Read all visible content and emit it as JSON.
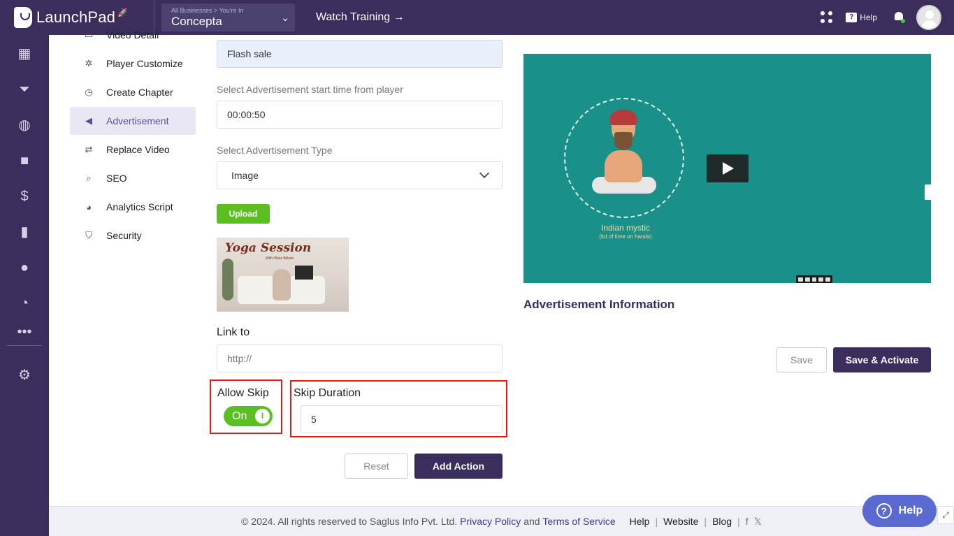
{
  "app": {
    "name": "LaunchPad"
  },
  "business": {
    "crumb": "All Businesses > You're In",
    "name": "Concepta"
  },
  "topnav": {
    "watch_training": "Watch Training →",
    "help": "Help"
  },
  "rail_icons": [
    "dashboard-icon",
    "funnel-icon",
    "globe-icon",
    "video-icon",
    "dollar-icon",
    "analytics-icon",
    "users-icon",
    "gauge-icon",
    "more-icon",
    "settings-icon"
  ],
  "submenu": {
    "items": [
      {
        "label": "Video Detail",
        "icon": "video-detail-icon"
      },
      {
        "label": "Player Customize",
        "icon": "customize-icon"
      },
      {
        "label": "Create Chapter",
        "icon": "stopwatch-icon"
      },
      {
        "label": "Advertisement",
        "icon": "megaphone-icon",
        "active": true
      },
      {
        "label": "Replace Video",
        "icon": "swap-icon"
      },
      {
        "label": "SEO",
        "icon": "seo-search-icon"
      },
      {
        "label": "Analytics Script",
        "icon": "pie-chart-icon"
      },
      {
        "label": "Security",
        "icon": "shield-icon"
      }
    ]
  },
  "form": {
    "ad_name_value": "Flash sale",
    "start_time_label": "Select Advertisement start time from player",
    "start_time_value": "00:00:50",
    "type_label": "Select Advertisement Type",
    "type_value": "Image",
    "upload_label": "Upload",
    "thumb_title": "Yoga Session",
    "thumb_sub": "With Olivia Wilson",
    "link_label": "Link to",
    "link_placeholder": "http://",
    "allow_skip_label": "Allow Skip",
    "allow_skip_state": "On",
    "toggle_knob": "I",
    "skip_duration_label": "Skip Duration",
    "skip_duration_value": "5",
    "reset_label": "Reset",
    "add_action_label": "Add Action"
  },
  "preview": {
    "caption": "Indian mystic",
    "subcaption": "(lot of time on hands)",
    "section_title": "Advertisement Information",
    "save_label": "Save",
    "save_activate_label": "Save & Activate"
  },
  "footer": {
    "copyright": "©  2024. All rights reserved to Saglus Info Pvt. Ltd.",
    "privacy": "Privacy Policy",
    "and": "and",
    "terms": "Terms of Service",
    "help": "Help",
    "website": "Website",
    "blog": "Blog",
    "divider": "|"
  },
  "fab": {
    "help": "Help",
    "icon_glyph": "?"
  },
  "colors": {
    "brand": "#3b2d5c",
    "accent_green": "#5bbf21",
    "highlight_red": "#e31b1b",
    "video_bg": "#1a9188"
  }
}
